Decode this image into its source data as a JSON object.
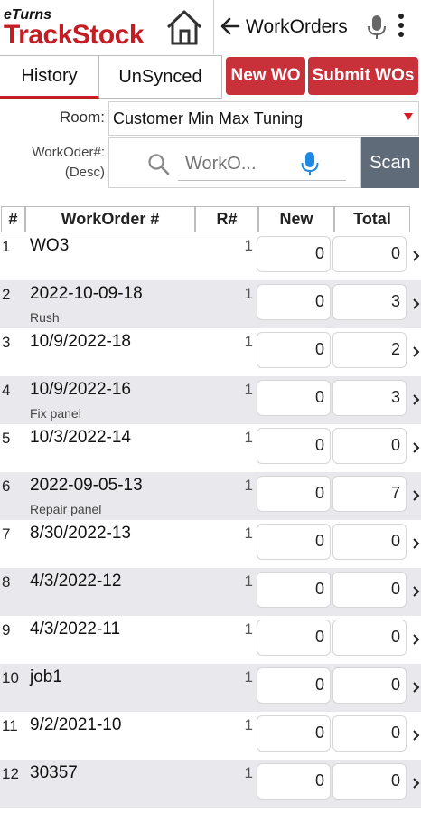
{
  "header": {
    "logo_small": "eTurns",
    "logo_big": "TrackStock",
    "title": "WorkOrders"
  },
  "tabs": [
    {
      "label": "History",
      "active": true
    },
    {
      "label": "UnSynced",
      "active": false
    }
  ],
  "actions": {
    "new_wo": "New WO",
    "submit_wos": "Submit WOs"
  },
  "filters": {
    "room_label": "Room:",
    "room_value": "Customer Min Max Tuning",
    "wo_label_line1": "WorkOder#:",
    "wo_label_line2": "(Desc)",
    "search_placeholder": "WorkO...",
    "scan_label": "Scan"
  },
  "table": {
    "headers": {
      "num": "#",
      "wo": "WorkOrder #",
      "r": "R#",
      "new": "New",
      "total": "Total"
    },
    "rows": [
      {
        "num": "1",
        "wo": "WO3",
        "desc": "",
        "r": "1",
        "new": "0",
        "total": "0"
      },
      {
        "num": "2",
        "wo": "2022-10-09-18",
        "desc": "Rush",
        "r": "1",
        "new": "0",
        "total": "3"
      },
      {
        "num": "3",
        "wo": "10/9/2022-18",
        "desc": "",
        "r": "1",
        "new": "0",
        "total": "2"
      },
      {
        "num": "4",
        "wo": "10/9/2022-16",
        "desc": "Fix panel",
        "r": "1",
        "new": "0",
        "total": "3"
      },
      {
        "num": "5",
        "wo": "10/3/2022-14",
        "desc": "",
        "r": "1",
        "new": "0",
        "total": "0"
      },
      {
        "num": "6",
        "wo": "2022-09-05-13",
        "desc": "Repair panel",
        "r": "1",
        "new": "0",
        "total": "7"
      },
      {
        "num": "7",
        "wo": "8/30/2022-13",
        "desc": "",
        "r": "1",
        "new": "0",
        "total": "0"
      },
      {
        "num": "8",
        "wo": "4/3/2022-12",
        "desc": "",
        "r": "1",
        "new": "0",
        "total": "0"
      },
      {
        "num": "9",
        "wo": "4/3/2022-11",
        "desc": "",
        "r": "1",
        "new": "0",
        "total": "0"
      },
      {
        "num": "10",
        "wo": "job1",
        "desc": "",
        "r": "1",
        "new": "0",
        "total": "0"
      },
      {
        "num": "11",
        "wo": "9/2/2021-10",
        "desc": "",
        "r": "1",
        "new": "0",
        "total": "0"
      },
      {
        "num": "12",
        "wo": "30357",
        "desc": "",
        "r": "1",
        "new": "0",
        "total": "0"
      }
    ]
  },
  "colors": {
    "brand_red": "#c41e24",
    "button_red": "#c8303a",
    "scan_gray": "#5f6b78",
    "mic_blue": "#1e88e5",
    "row_alt": "#e9e9ed"
  },
  "icons": [
    "house-icon",
    "back-arrow-icon",
    "mic-icon",
    "more-vert-icon",
    "search-icon",
    "dropdown-caret-icon",
    "chevron-right-icon"
  ]
}
